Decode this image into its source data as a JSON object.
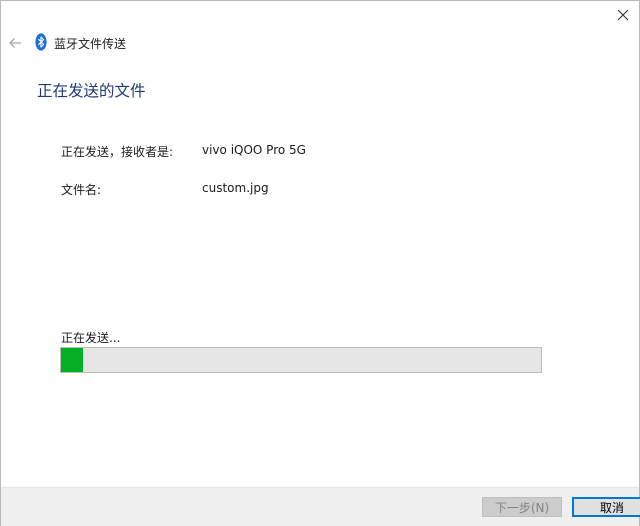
{
  "window": {
    "title": "蓝牙文件传送",
    "heading": "正在发送的文件"
  },
  "info": {
    "recipient_label": "正在发送，接收者是:",
    "recipient_value": "vivo iQOO Pro 5G",
    "filename_label": "文件名:",
    "filename_value": "custom.jpg"
  },
  "progress": {
    "label": "正在发送...",
    "percent": 4.5,
    "color": "#06b025"
  },
  "buttons": {
    "next_label": "下一步(N)",
    "cancel_label": "取消"
  },
  "icons": {
    "close": "close-icon",
    "back": "back-arrow-icon",
    "bluetooth": "bluetooth-icon"
  },
  "colors": {
    "heading": "#1f3a7a",
    "progress_track": "#e6e6e6",
    "focus_border": "#0078d7"
  }
}
